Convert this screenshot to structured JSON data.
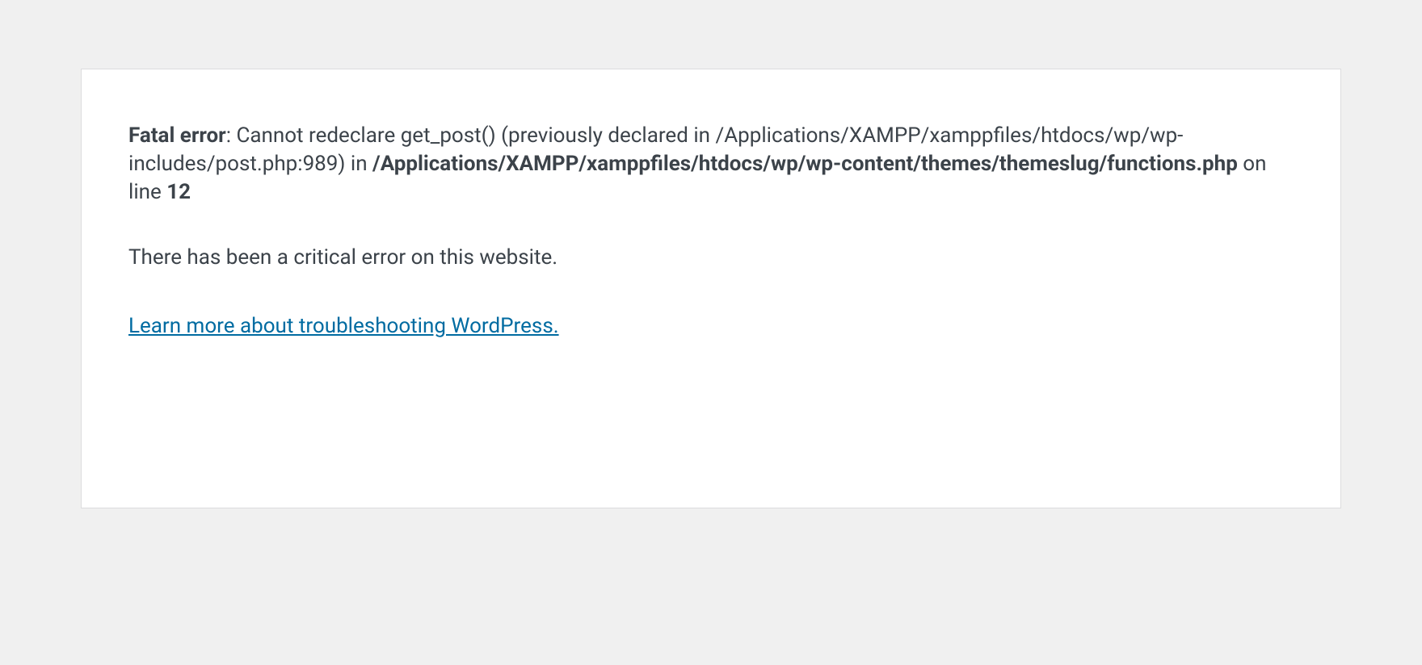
{
  "error": {
    "label": "Fatal error",
    "description_part1": ": Cannot redeclare get_post() (previously declared in /Applications/XAMPP/xamppfiles/htdocs/wp/wp-includes/post.php:989) in ",
    "file_path": "/Applications/XAMPP/xamppfiles/htdocs/wp/wp-content/themes/themeslug/functions.php",
    "on_line_text": " on line ",
    "line_number": "12"
  },
  "critical_error_text": "There has been a critical error on this website.",
  "link": {
    "text": "Learn more about troubleshooting WordPress."
  }
}
